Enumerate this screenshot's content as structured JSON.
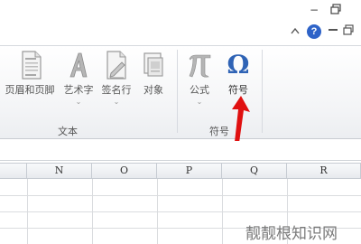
{
  "ribbon": {
    "buttons": [
      {
        "label": "页眉和页脚",
        "icon": "header-footer-icon"
      },
      {
        "label": "艺术字",
        "icon": "wordart-icon"
      },
      {
        "label": "签名行",
        "icon": "signature-line-icon"
      },
      {
        "label": "对象",
        "icon": "object-icon"
      },
      {
        "label": "公式",
        "icon": "equation-pi-icon"
      },
      {
        "label": "符号",
        "icon": "symbol-omega-icon"
      }
    ],
    "groups": {
      "text": "文本",
      "symbols": "符号"
    }
  },
  "sheet": {
    "columns": [
      "N",
      "O",
      "P",
      "Q",
      "R"
    ]
  },
  "window": {
    "help": "?"
  },
  "watermark": "靓靓根知识网",
  "colors": {
    "arrow": "#e01010",
    "omega": "#2f63b5",
    "help": "#2e63c8"
  }
}
